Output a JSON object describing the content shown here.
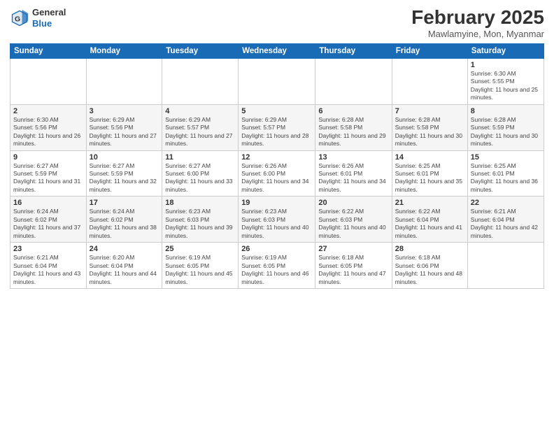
{
  "logo": {
    "general": "General",
    "blue": "Blue"
  },
  "title": {
    "month_year": "February 2025",
    "location": "Mawlamyine, Mon, Myanmar"
  },
  "weekdays": [
    "Sunday",
    "Monday",
    "Tuesday",
    "Wednesday",
    "Thursday",
    "Friday",
    "Saturday"
  ],
  "weeks": [
    [
      {
        "day": "",
        "info": ""
      },
      {
        "day": "",
        "info": ""
      },
      {
        "day": "",
        "info": ""
      },
      {
        "day": "",
        "info": ""
      },
      {
        "day": "",
        "info": ""
      },
      {
        "day": "",
        "info": ""
      },
      {
        "day": "1",
        "info": "Sunrise: 6:30 AM\nSunset: 5:55 PM\nDaylight: 11 hours and 25 minutes."
      }
    ],
    [
      {
        "day": "2",
        "info": "Sunrise: 6:30 AM\nSunset: 5:56 PM\nDaylight: 11 hours and 26 minutes."
      },
      {
        "day": "3",
        "info": "Sunrise: 6:29 AM\nSunset: 5:56 PM\nDaylight: 11 hours and 27 minutes."
      },
      {
        "day": "4",
        "info": "Sunrise: 6:29 AM\nSunset: 5:57 PM\nDaylight: 11 hours and 27 minutes."
      },
      {
        "day": "5",
        "info": "Sunrise: 6:29 AM\nSunset: 5:57 PM\nDaylight: 11 hours and 28 minutes."
      },
      {
        "day": "6",
        "info": "Sunrise: 6:28 AM\nSunset: 5:58 PM\nDaylight: 11 hours and 29 minutes."
      },
      {
        "day": "7",
        "info": "Sunrise: 6:28 AM\nSunset: 5:58 PM\nDaylight: 11 hours and 30 minutes."
      },
      {
        "day": "8",
        "info": "Sunrise: 6:28 AM\nSunset: 5:59 PM\nDaylight: 11 hours and 30 minutes."
      }
    ],
    [
      {
        "day": "9",
        "info": "Sunrise: 6:27 AM\nSunset: 5:59 PM\nDaylight: 11 hours and 31 minutes."
      },
      {
        "day": "10",
        "info": "Sunrise: 6:27 AM\nSunset: 5:59 PM\nDaylight: 11 hours and 32 minutes."
      },
      {
        "day": "11",
        "info": "Sunrise: 6:27 AM\nSunset: 6:00 PM\nDaylight: 11 hours and 33 minutes."
      },
      {
        "day": "12",
        "info": "Sunrise: 6:26 AM\nSunset: 6:00 PM\nDaylight: 11 hours and 34 minutes."
      },
      {
        "day": "13",
        "info": "Sunrise: 6:26 AM\nSunset: 6:01 PM\nDaylight: 11 hours and 34 minutes."
      },
      {
        "day": "14",
        "info": "Sunrise: 6:25 AM\nSunset: 6:01 PM\nDaylight: 11 hours and 35 minutes."
      },
      {
        "day": "15",
        "info": "Sunrise: 6:25 AM\nSunset: 6:01 PM\nDaylight: 11 hours and 36 minutes."
      }
    ],
    [
      {
        "day": "16",
        "info": "Sunrise: 6:24 AM\nSunset: 6:02 PM\nDaylight: 11 hours and 37 minutes."
      },
      {
        "day": "17",
        "info": "Sunrise: 6:24 AM\nSunset: 6:02 PM\nDaylight: 11 hours and 38 minutes."
      },
      {
        "day": "18",
        "info": "Sunrise: 6:23 AM\nSunset: 6:03 PM\nDaylight: 11 hours and 39 minutes."
      },
      {
        "day": "19",
        "info": "Sunrise: 6:23 AM\nSunset: 6:03 PM\nDaylight: 11 hours and 40 minutes."
      },
      {
        "day": "20",
        "info": "Sunrise: 6:22 AM\nSunset: 6:03 PM\nDaylight: 11 hours and 40 minutes."
      },
      {
        "day": "21",
        "info": "Sunrise: 6:22 AM\nSunset: 6:04 PM\nDaylight: 11 hours and 41 minutes."
      },
      {
        "day": "22",
        "info": "Sunrise: 6:21 AM\nSunset: 6:04 PM\nDaylight: 11 hours and 42 minutes."
      }
    ],
    [
      {
        "day": "23",
        "info": "Sunrise: 6:21 AM\nSunset: 6:04 PM\nDaylight: 11 hours and 43 minutes."
      },
      {
        "day": "24",
        "info": "Sunrise: 6:20 AM\nSunset: 6:04 PM\nDaylight: 11 hours and 44 minutes."
      },
      {
        "day": "25",
        "info": "Sunrise: 6:19 AM\nSunset: 6:05 PM\nDaylight: 11 hours and 45 minutes."
      },
      {
        "day": "26",
        "info": "Sunrise: 6:19 AM\nSunset: 6:05 PM\nDaylight: 11 hours and 46 minutes."
      },
      {
        "day": "27",
        "info": "Sunrise: 6:18 AM\nSunset: 6:05 PM\nDaylight: 11 hours and 47 minutes."
      },
      {
        "day": "28",
        "info": "Sunrise: 6:18 AM\nSunset: 6:06 PM\nDaylight: 11 hours and 48 minutes."
      },
      {
        "day": "",
        "info": ""
      }
    ]
  ]
}
